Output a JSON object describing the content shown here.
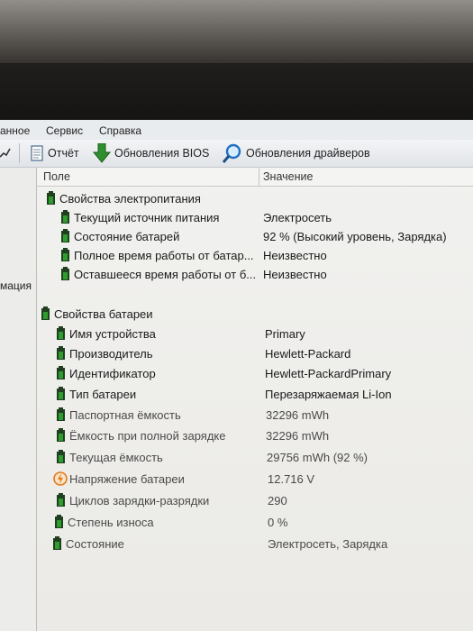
{
  "menu": {
    "items": [
      "анное",
      "Сервис",
      "Справка"
    ]
  },
  "toolbar": {
    "report_label": "Отчёт",
    "bios_label": "Обновления BIOS",
    "drivers_label": "Обновления драйверов"
  },
  "left_panel": {
    "fragment": "мация"
  },
  "table": {
    "col_field": "Поле",
    "col_value": "Значение",
    "groups": [
      {
        "title": "Свойства электропитания",
        "rows": [
          {
            "field": "Текущий источник питания",
            "value": "Электросеть"
          },
          {
            "field": "Состояние батарей",
            "value": "92 % (Высокий уровень, Зарядка)"
          },
          {
            "field": "Полное время работы от батар...",
            "value": "Неизвестно"
          },
          {
            "field": "Оставшееся время работы от б...",
            "value": "Неизвестно"
          }
        ]
      },
      {
        "title": "Свойства батареи",
        "rows": [
          {
            "field": "Имя устройства",
            "value": "Primary",
            "icon": "battery-icon"
          },
          {
            "field": "Производитель",
            "value": "Hewlett-Packard",
            "icon": "battery-icon"
          },
          {
            "field": "Идентификатор",
            "value": "Hewlett-PackardPrimary",
            "icon": "battery-icon"
          },
          {
            "field": "Тип батареи",
            "value": "Перезаряжаемая Li-Ion",
            "icon": "battery-icon"
          },
          {
            "field": "Паспортная ёмкость",
            "value": "32296 mWh",
            "icon": "battery-icon"
          },
          {
            "field": "Ёмкость при полной зарядке",
            "value": "32296 mWh",
            "icon": "battery-icon"
          },
          {
            "field": "Текущая ёмкость",
            "value": "29756 mWh  (92 %)",
            "icon": "battery-icon"
          },
          {
            "field": "Напряжение батареи",
            "value": "12.716 V",
            "icon": "voltage-icon"
          },
          {
            "field": "Циклов зарядки-разрядки",
            "value": "290",
            "icon": "battery-icon"
          },
          {
            "field": "Степень износа",
            "value": "0 %",
            "icon": "battery-icon"
          },
          {
            "field": "Состояние",
            "value": "Электросеть, Зарядка",
            "icon": "battery-icon"
          }
        ]
      }
    ]
  },
  "colors": {
    "battery_green": "#2e9d2e",
    "battery_dark": "#1f3f1f",
    "voltage_orange": "#e07a1a"
  }
}
